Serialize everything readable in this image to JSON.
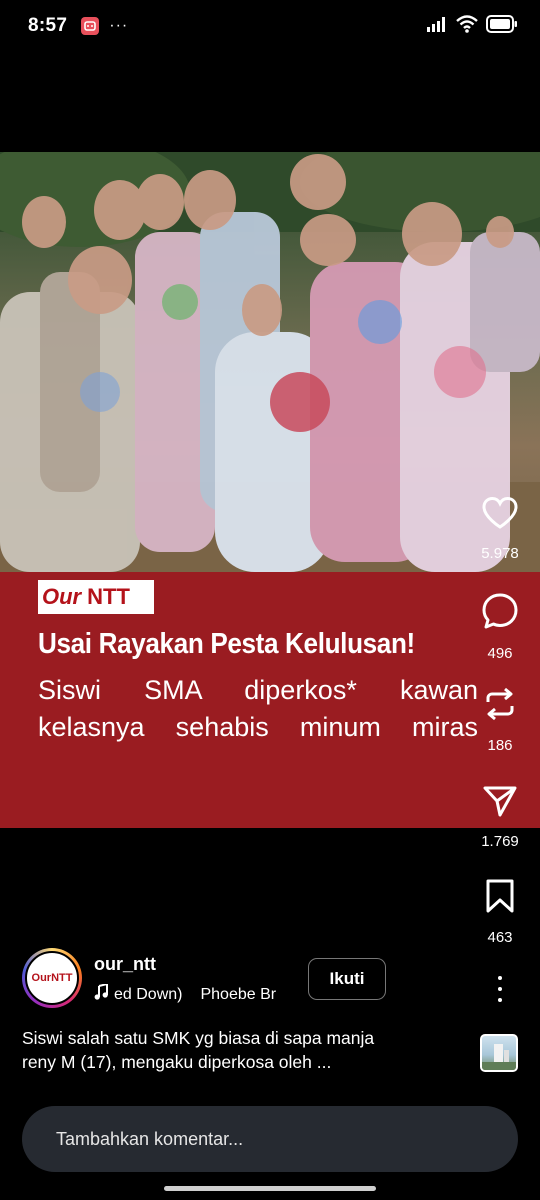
{
  "status_bar": {
    "time": "8:57",
    "extra": "···"
  },
  "post": {
    "brand": {
      "logo_part1": "Our",
      "logo_part2": "NTT"
    },
    "headline": "Usai Rayakan Pesta Kelulusan!",
    "subline": [
      "Siswi SMA diperkos* kawan",
      "kelasnya sehabis minum miras"
    ]
  },
  "actions": {
    "likes": "5.978",
    "comments": "496",
    "reposts": "186",
    "shares": "1.769",
    "saves": "463"
  },
  "author": {
    "avatar_text": "OurNTT",
    "username": "our_ntt",
    "music_title": "ed Down)",
    "music_artist": "Phoebe Br",
    "follow_label": "Ikuti"
  },
  "caption": [
    "Siswi salah satu SMK yg biasa di sapa manja",
    "reny M (17), mengaku diperkosa oleh ..."
  ],
  "comment": {
    "placeholder": "Tambahkan komentar..."
  },
  "colors": {
    "banner": "#9a1c21",
    "brand_red": "#b4121a",
    "comment_bg": "#262a31"
  },
  "icons": [
    "app-badge-icon",
    "signal-icon",
    "wifi-icon",
    "battery-icon",
    "heart-icon",
    "comment-icon",
    "repost-icon",
    "send-icon",
    "bookmark-icon",
    "music-note-icon",
    "more-vertical-icon"
  ]
}
